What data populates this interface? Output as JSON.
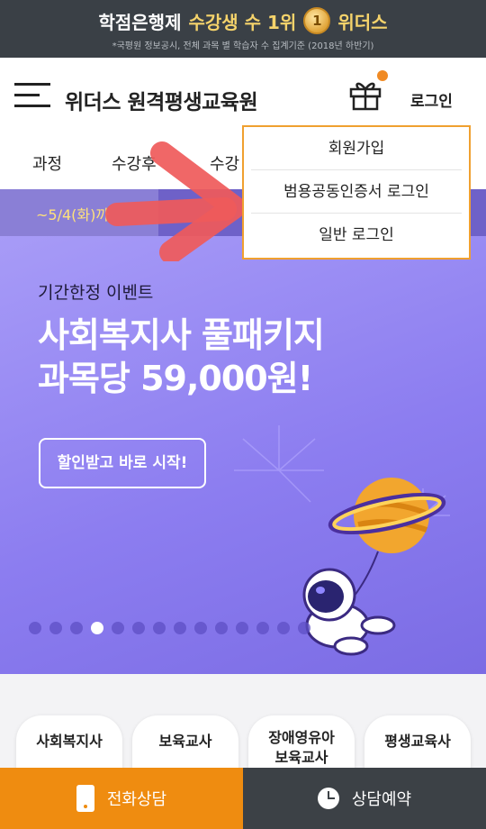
{
  "topbar": {
    "prefix": "학점은행제",
    "highlight": "수강생 수 1위",
    "medal": "1",
    "brand": "위더스",
    "footnote": "*국평원 정보공시, 전체 과목 별 학습자 수 집계기준 (2018년 하반기)"
  },
  "header": {
    "logo": "위더스 원격평생교육원",
    "login_label": "로그인"
  },
  "nav": {
    "tabs": [
      "과정",
      "수강후",
      "수강"
    ]
  },
  "notice": {
    "text": "~5/4(화)까"
  },
  "dropdown": {
    "items": [
      "회원가입",
      "범용공동인증서 로그인",
      "일반 로그인"
    ]
  },
  "hero": {
    "eyebrow": "기간한정 이벤트",
    "title_line1": "사회복지사 풀패키지",
    "title_line2": "과목당 59,000원!",
    "cta": "할인받고 바로 시작!",
    "slide_count": 14,
    "active_slide": 4
  },
  "cards": [
    "사회복지사",
    "보육교사",
    "장애영유아\n보육교사",
    "평생교육사"
  ],
  "bottom": {
    "call_label": "전화상담",
    "book_label": "상담예약"
  },
  "colors": {
    "accent_orange": "#ef8c10",
    "dark": "#3c4146",
    "hero_purple": "#8c7df0"
  }
}
